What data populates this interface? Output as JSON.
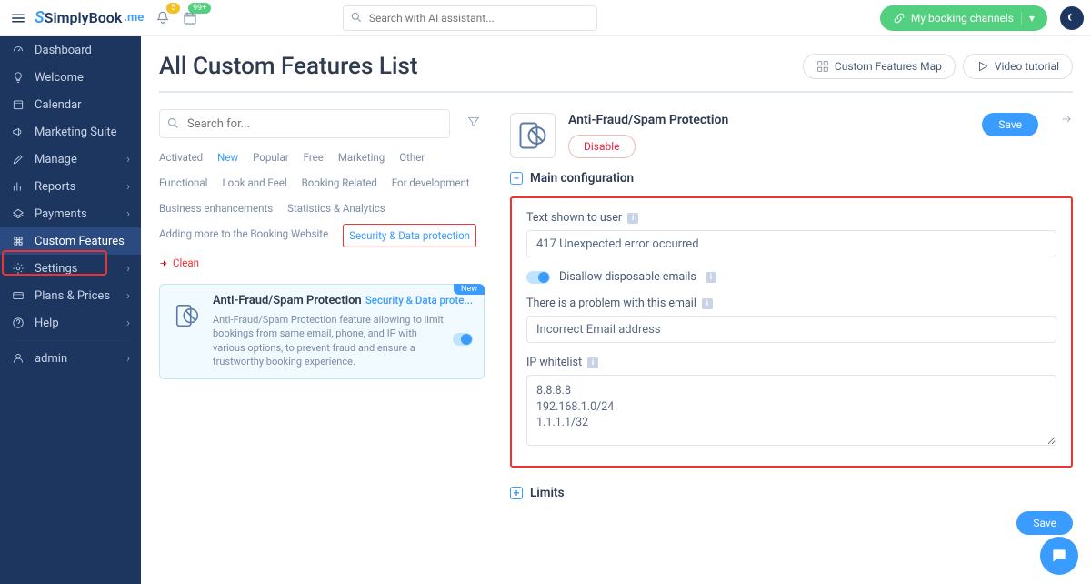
{
  "topbar": {
    "logo_main": "SimplyBook",
    "logo_suffix": ".me",
    "bell_badge": "5",
    "cal_badge": "99+",
    "search_placeholder": "Search with AI assistant...",
    "booking_btn": "My booking channels"
  },
  "sidebar": {
    "items": [
      {
        "label": "Dashboard"
      },
      {
        "label": "Welcome"
      },
      {
        "label": "Calendar"
      },
      {
        "label": "Marketing Suite"
      },
      {
        "label": "Manage",
        "chev": true
      },
      {
        "label": "Reports",
        "chev": true
      },
      {
        "label": "Payments",
        "chev": true
      },
      {
        "label": "Custom Features",
        "active": true
      },
      {
        "label": "Settings",
        "chev": true
      },
      {
        "label": "Plans & Prices",
        "chev": true
      },
      {
        "label": "Help",
        "chev": true
      }
    ],
    "admin_label": "admin"
  },
  "page": {
    "title": "All Custom Features List",
    "features_map": "Custom Features Map",
    "video_tutorial": "Video tutorial",
    "search_placeholder": "Search for..."
  },
  "categories": {
    "activated": "Activated",
    "new": "New",
    "popular": "Popular",
    "free": "Free",
    "marketing": "Marketing",
    "other": "Other",
    "functional": "Functional",
    "look": "Look and Feel",
    "booking": "Booking Related",
    "dev": "For development",
    "biz": "Business enhancements",
    "stats": "Statistics & Analytics",
    "adding": "Adding more to the Booking Website",
    "security": "Security & Data protection",
    "clean": "Clean"
  },
  "feature_card": {
    "new_tag": "New",
    "title": "Anti-Fraud/Spam Protection",
    "link": "Security & Data prote...",
    "desc": "Anti-Fraud/Spam Protection feature allowing to limit bookings from same email, phone, and IP with various options, to prevent fraud and ensure a trustworthy booking experience."
  },
  "detail": {
    "title": "Anti-Fraud/Spam Protection",
    "disable": "Disable",
    "save": "Save"
  },
  "main_config": {
    "heading": "Main configuration",
    "text_shown_label": "Text shown to user",
    "text_shown_value": "417 Unexpected error occurred",
    "disallow_label": "Disallow disposable emails",
    "problem_label": "There is a problem with this email",
    "problem_value": "Incorrect Email address",
    "ip_label": "IP whitelist",
    "ip_value": "8.8.8.8\n192.168.1.0/24\n1.1.1.1/32"
  },
  "limits": {
    "heading": "Limits"
  }
}
